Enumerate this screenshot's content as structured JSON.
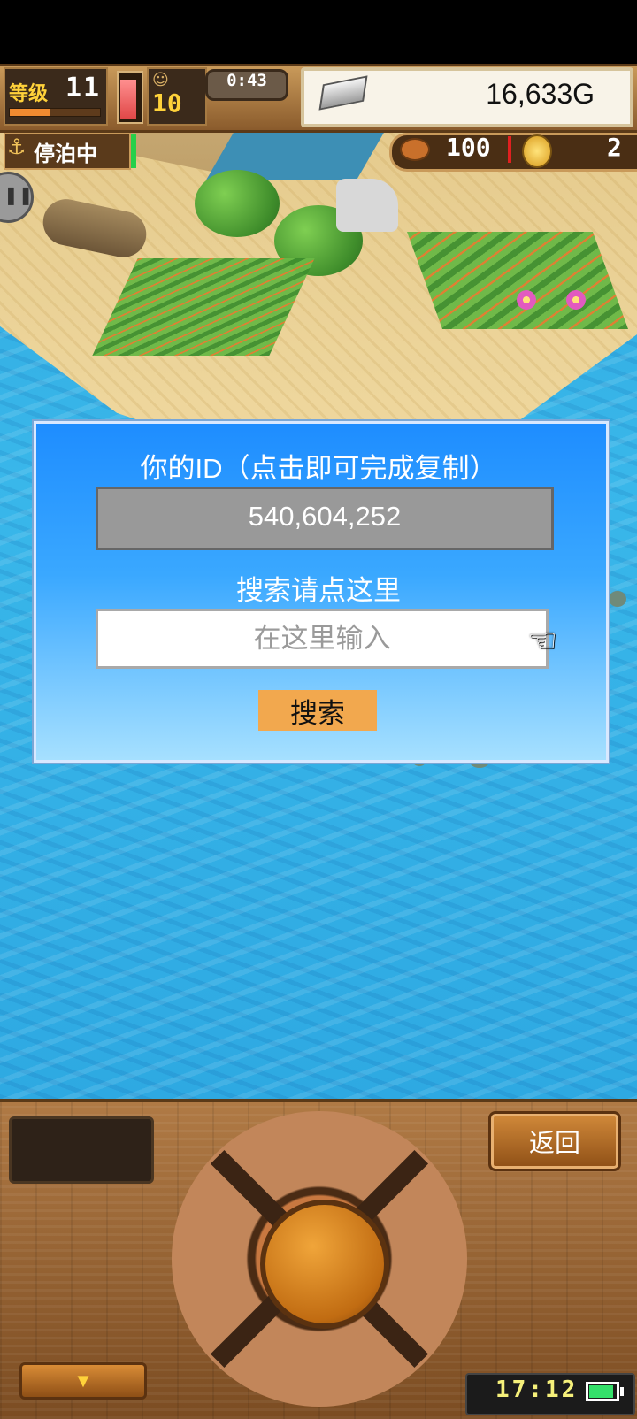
{
  "hud": {
    "level_label": "等级",
    "level_value": "11",
    "level_xp_fraction": 0.45,
    "stamina_fraction": 0.85,
    "stat_icon": "person-icon",
    "stat_value": "10",
    "timer": "0:43",
    "money_value": "16,633G",
    "anchor_label": "停泊中",
    "food_value": "100",
    "coin_value": "2"
  },
  "dialog": {
    "id_label": "你的ID（点击即可完成复制）",
    "id_value": "540,604,252",
    "search_label": "搜索请点这里",
    "search_placeholder": "在这里输入",
    "search_value": "",
    "search_button": "搜索"
  },
  "controls": {
    "back_button": "返回",
    "expand_icon": "▼",
    "clock": "17:12",
    "battery_fraction": 0.9
  },
  "colors": {
    "dialog_top": "#1e8dff",
    "dialog_bottom": "#a6e0ff",
    "search_button_bg": "#f2a84e",
    "money_text": "#111111",
    "level_label": "#ffd23a"
  }
}
